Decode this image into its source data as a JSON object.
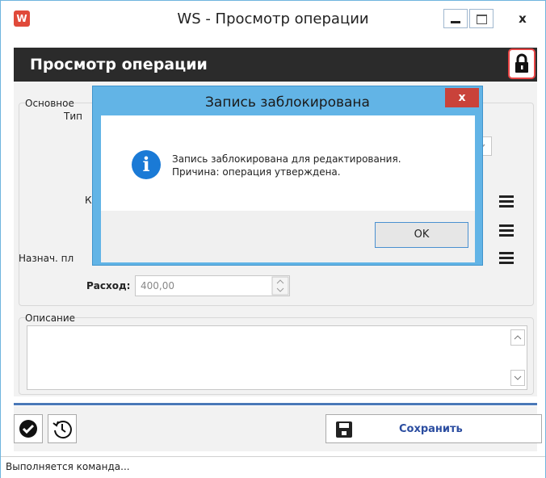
{
  "window": {
    "title": "WS - Просмотр операции",
    "minimize": "–",
    "maximize": "□",
    "close": "x"
  },
  "header": {
    "title": "Просмотр операции"
  },
  "form": {
    "group_main": "Основное",
    "type_label": "Тип",
    "k_label": "К",
    "purpose_label": "Назнач. пл",
    "expense_label": "Расход:",
    "expense_value": "400,00",
    "description_group": "Описание"
  },
  "modal": {
    "title": "Запись заблокирована",
    "close": "x",
    "message_line1": "Запись заблокирована для редактирования.",
    "message_line2": "Причина: операция утверждена.",
    "ok": "OK"
  },
  "toolbar": {
    "save_label": "Сохранить"
  },
  "status": {
    "text": "Выполняется команда..."
  },
  "colors": {
    "header_bg": "#2b2b2b",
    "modal_frame": "#62b4e6",
    "lock_border": "#e84545",
    "save_text": "#2b4da0",
    "info": "#1a7ad6"
  }
}
